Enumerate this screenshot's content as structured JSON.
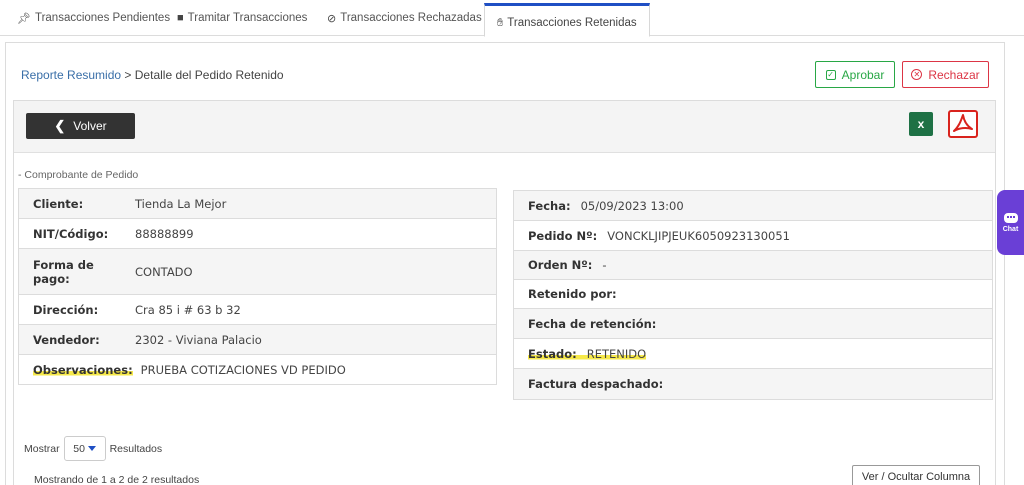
{
  "tabs": [
    {
      "icon": "pin-icon",
      "label": "Transacciones Pendientes"
    },
    {
      "icon": "truck-icon",
      "label": "Tramitar Transacciones"
    },
    {
      "icon": "ban-icon",
      "label": "Transacciones Rechazadas"
    },
    {
      "icon": "hand-icon",
      "label": "Transacciones Retenidas",
      "active": true
    }
  ],
  "breadcrumb": {
    "link": "Reporte Resumido",
    "separator": ">",
    "current": "Detalle del Pedido Retenido"
  },
  "actions": {
    "approve_label": "Aprobar",
    "reject_label": "Rechazar"
  },
  "toolbar": {
    "back_label": "Volver",
    "excel_letter": "x"
  },
  "section_label": "- Comprobante de Pedido",
  "left_table": [
    {
      "label": "Cliente:",
      "value": "Tienda La Mejor"
    },
    {
      "label": "NIT/Código:",
      "value": "88888899"
    },
    {
      "label": "Forma de pago:",
      "value": "CONTADO"
    },
    {
      "label": "Dirección:",
      "value": "Cra 85 i # 63 b 32"
    },
    {
      "label": "Vendedor:",
      "value": "2302 - Viviana Palacio"
    },
    {
      "label": "Observaciones:",
      "value": "PRUEBA COTIZACIONES VD PEDIDO"
    }
  ],
  "right_table": [
    {
      "label": "Fecha:",
      "value": "05/09/2023 13:00"
    },
    {
      "label": "Pedido Nº:",
      "value": "VONCKLJIPJEUK6050923130051"
    },
    {
      "label": "Orden Nº:",
      "value": "-"
    },
    {
      "label": "Retenido por:",
      "value": ""
    },
    {
      "label": "Fecha de retención:",
      "value": ""
    },
    {
      "label": "Estado:",
      "value": "RETENIDO"
    },
    {
      "label": "Factura despachado:",
      "value": ""
    }
  ],
  "pagination": {
    "show_label": "Mostrar",
    "page_size": "50",
    "results_label": "Resultados",
    "summary": "Mostrando de 1 a 2 de 2 resultados"
  },
  "columns_button": "Ver / Ocultar Columna",
  "chat": {
    "label": "Chat"
  },
  "colors": {
    "accent": "#1f4fc4",
    "approve": "#28a745",
    "reject": "#dc3545",
    "highlight": "#f6e94a",
    "chat": "#6a3fd6"
  }
}
